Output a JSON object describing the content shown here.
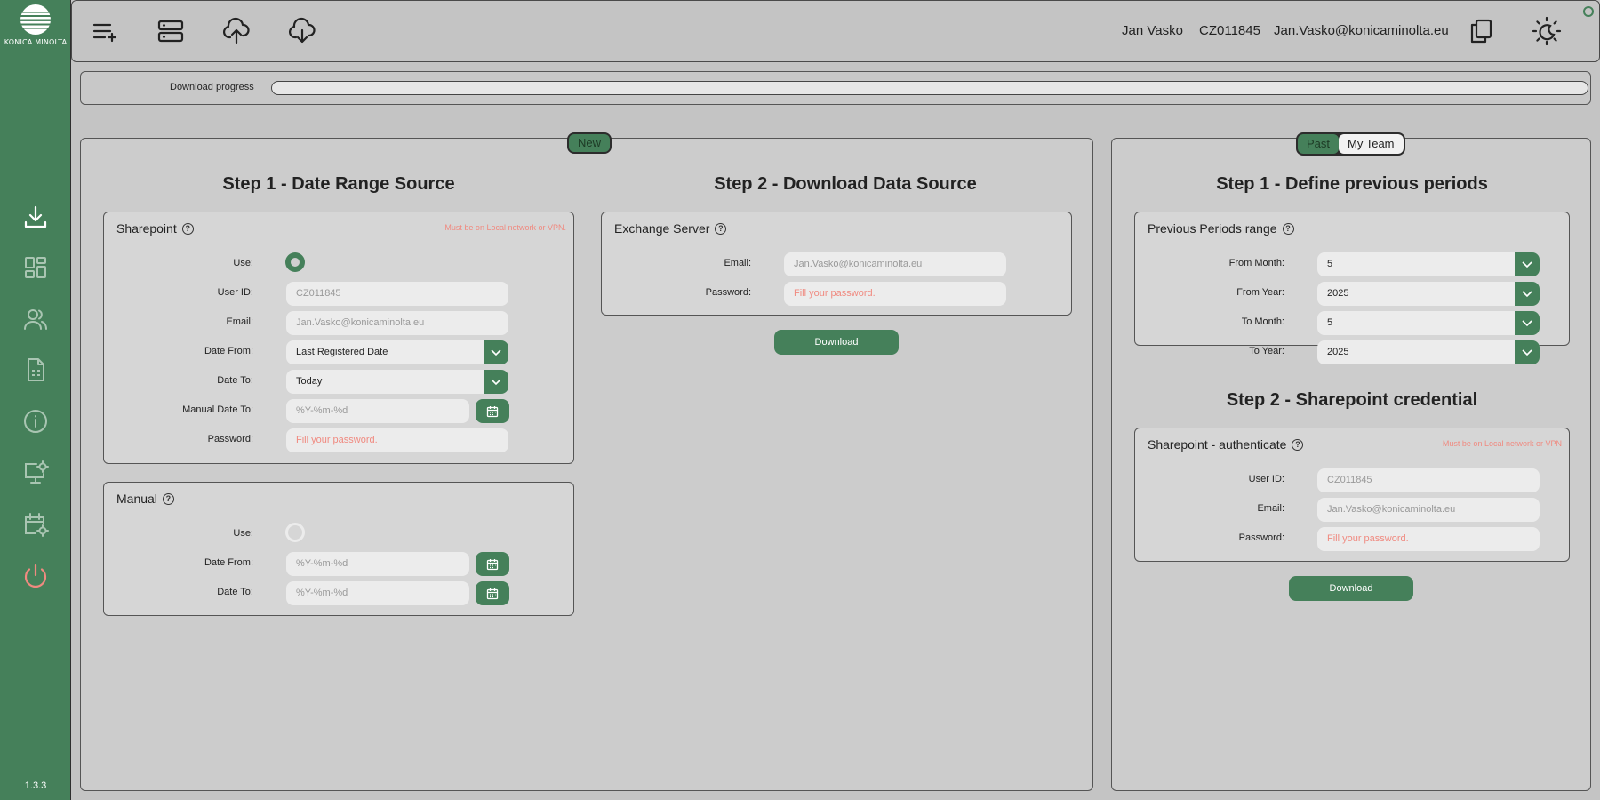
{
  "app": {
    "logo_text": "KONICA MINOLTA",
    "version": "1.3.3",
    "accent_color": "#45805a",
    "danger_color": "#f08a80"
  },
  "sidebar": {
    "items": [
      {
        "name": "download",
        "icon": "download-icon"
      },
      {
        "name": "dashboard",
        "icon": "dashboard-icon"
      },
      {
        "name": "users",
        "icon": "users-icon"
      },
      {
        "name": "report",
        "icon": "spreadsheet-icon"
      },
      {
        "name": "info",
        "icon": "info-icon"
      },
      {
        "name": "monitor-settings",
        "icon": "monitor-gear-icon"
      },
      {
        "name": "calendar-settings",
        "icon": "calendar-gear-icon"
      },
      {
        "name": "power",
        "icon": "power-icon"
      }
    ]
  },
  "topbar": {
    "buttons": [
      "add-list-icon",
      "server-icon",
      "cloud-upload-icon",
      "cloud-download-icon"
    ],
    "user_name": "Jan Vasko",
    "user_id": "CZ011845",
    "user_email": "Jan.Vasko@konicaminolta.eu"
  },
  "progress": {
    "label": "Download progress",
    "value": 0
  },
  "left_panel": {
    "tab": "New",
    "step1_title": "Step 1 - Date Range Source",
    "step2_title": "Step 2 - Download Data Source",
    "sharepoint": {
      "title": "Sharepoint",
      "warning": "Must be on Local network or VPN.",
      "use_label": "Use:",
      "use_selected": true,
      "user_id_label": "User ID:",
      "user_id_value": "CZ011845",
      "email_label": "Email:",
      "email_value": "Jan.Vasko@konicaminolta.eu",
      "date_from_label": "Date From:",
      "date_from_value": "Last Registered Date",
      "date_to_label": "Date To:",
      "date_to_value": "Today",
      "manual_date_to_label": "Manual Date To:",
      "manual_date_to_placeholder": "%Y-%m-%d",
      "password_label": "Password:",
      "password_placeholder": "Fill your password."
    },
    "manual": {
      "title": "Manual",
      "use_label": "Use:",
      "use_selected": false,
      "date_from_label": "Date From:",
      "date_from_placeholder": "%Y-%m-%d",
      "date_to_label": "Date To:",
      "date_to_placeholder": "%Y-%m-%d"
    },
    "exchange": {
      "title": "Exchange Server",
      "email_label": "Email:",
      "email_value": "Jan.Vasko@konicaminolta.eu",
      "password_label": "Password:",
      "password_placeholder": "Fill your password."
    },
    "download_label": "Download"
  },
  "right_panel": {
    "tabs": [
      "Past",
      "My Team"
    ],
    "active_tab": "Past",
    "step1_title": "Step 1 - Define previous periods",
    "periods": {
      "title": "Previous Periods range",
      "from_month_label": "From Month:",
      "from_month_value": "5",
      "from_year_label": "From Year:",
      "from_year_value": "2025",
      "to_month_label": "To Month:",
      "to_month_value": "5",
      "to_year_label": "To Year:",
      "to_year_value": "2025"
    },
    "step2_title": "Step 2 - Sharepoint credential",
    "auth": {
      "title": "Sharepoint - authenticate",
      "warning": "Must be on Local network or VPN",
      "user_id_label": "User ID:",
      "user_id_value": "CZ011845",
      "email_label": "Email:",
      "email_value": "Jan.Vasko@konicaminolta.eu",
      "password_label": "Password:",
      "password_placeholder": "Fill your password."
    },
    "download_label": "Download"
  }
}
